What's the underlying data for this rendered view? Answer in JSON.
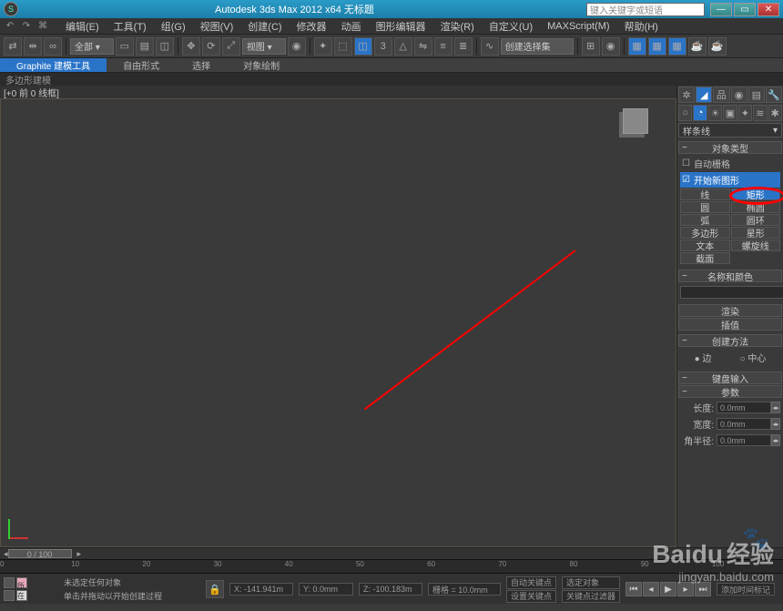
{
  "title": "Autodesk 3ds Max 2012 x64   无标题",
  "search_placeholder": "键入关键字或短语",
  "menu": [
    "编辑(E)",
    "工具(T)",
    "组(G)",
    "视图(V)",
    "创建(C)",
    "修改器",
    "动画",
    "图形编辑器",
    "渲染(R)",
    "自定义(U)",
    "MAXScript(M)",
    "帮助(H)"
  ],
  "toolbar_combo1": "全部",
  "toolbar_combo2": "视图",
  "toolbar_combo3": "创建选择集",
  "ribbon_tabs": [
    "Graphite 建模工具",
    "自由形式",
    "选择",
    "对象绘制"
  ],
  "ribbon_sub": "多边形建模",
  "vp_label": "[+0 前 0 线框]",
  "side": {
    "combo": "样条线",
    "rollouts": {
      "obj_type": "对象类型",
      "auto_grid": "自动栅格",
      "start_new": "开始新图形",
      "name_color": "名称和颜色",
      "render": "渲染",
      "interp": "插值",
      "create_method": "创建方法",
      "keyboard": "键盘输入",
      "params": "参数"
    },
    "shapes": [
      [
        "线",
        "矩形"
      ],
      [
        "圆",
        "椭圆"
      ],
      [
        "弧",
        "圆环"
      ],
      [
        "多边形",
        "星形"
      ],
      [
        "文本",
        "螺旋线"
      ],
      [
        "截面",
        ""
      ]
    ],
    "method_opts": [
      "边",
      "中心"
    ],
    "param_labels": [
      "长度:",
      "宽度:",
      "角半径:"
    ],
    "param_vals": [
      "0.0mm",
      "0.0mm",
      "0.0mm"
    ]
  },
  "time": {
    "slider": "0 / 100",
    "ticks": [
      "0",
      "10",
      "20",
      "30",
      "40",
      "50",
      "60",
      "70",
      "80",
      "90",
      "100"
    ]
  },
  "status": {
    "none_sel": "未选定任何对象",
    "hint": "单击并拖动以开始创建过程",
    "now": "所在行",
    "x": "X: -141.941m",
    "y": "Y: 0.0mm",
    "z": "Z: -100.183m",
    "grid": "栅格 = 10.0mm",
    "auto_key": "自动关键点",
    "sel_obj": "选定对象",
    "set_key": "设置关键点",
    "key_filter": "关键点过滤器",
    "add_time": "添加时间标记"
  },
  "watermark": {
    "main": "Baidu",
    "cn": "经验",
    "sub": "jingyan.baidu.com"
  }
}
